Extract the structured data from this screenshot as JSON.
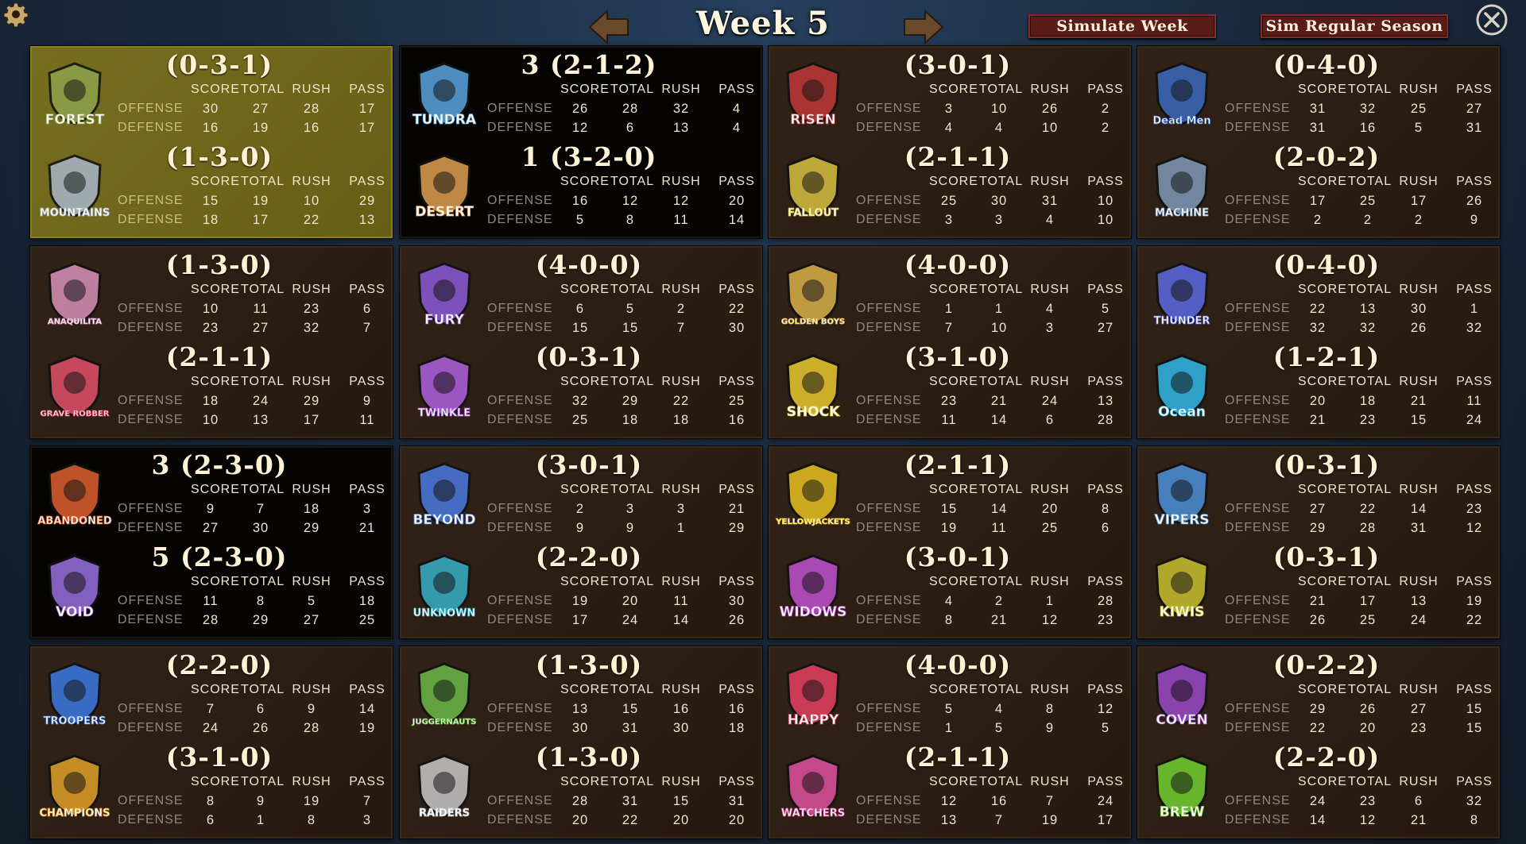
{
  "screen_title": "Week 5",
  "buttons": {
    "simulate_week": "Simulate Week",
    "sim_regular_season": "Sim Regular Season"
  },
  "stat_headers": [
    "SCORE",
    "TOTAL",
    "RUSH",
    "PASS"
  ],
  "row_labels": [
    "OFFENSE",
    "DEFENSE"
  ],
  "matchups": [
    {
      "state": "selected",
      "teams": [
        {
          "name": "FOREST",
          "logo_color": "#8fa24a",
          "record": "(0-3-1)",
          "offense": [
            30,
            27,
            28,
            17
          ],
          "defense": [
            16,
            19,
            16,
            17
          ]
        },
        {
          "name": "MOUNTAINS",
          "logo_color": "#a9b6c8",
          "record": "(1-3-0)",
          "offense": [
            15,
            19,
            10,
            29
          ],
          "defense": [
            18,
            17,
            22,
            13
          ]
        }
      ]
    },
    {
      "state": "live",
      "teams": [
        {
          "name": "TUNDRA",
          "logo_color": "#5aa6e0",
          "record": "3 (2-1-2)",
          "offense": [
            26,
            28,
            32,
            4
          ],
          "defense": [
            12,
            6,
            13,
            4
          ]
        },
        {
          "name": "DESERT",
          "logo_color": "#e0a050",
          "record": "1 (3-2-0)",
          "offense": [
            16,
            12,
            12,
            20
          ],
          "defense": [
            5,
            8,
            11,
            14
          ]
        }
      ]
    },
    {
      "state": "normal",
      "teams": [
        {
          "name": "RISEN",
          "logo_color": "#c03838",
          "record": "(3-0-1)",
          "offense": [
            3,
            10,
            26,
            2
          ],
          "defense": [
            4,
            4,
            10,
            2
          ]
        },
        {
          "name": "FALLOUT",
          "logo_color": "#d8c040",
          "record": "(2-1-1)",
          "offense": [
            25,
            30,
            31,
            10
          ],
          "defense": [
            3,
            3,
            4,
            10
          ]
        }
      ]
    },
    {
      "state": "normal",
      "teams": [
        {
          "name": "Dead Men",
          "logo_color": "#3a6ac0",
          "record": "(0-4-0)",
          "offense": [
            31,
            32,
            25,
            27
          ],
          "defense": [
            31,
            16,
            5,
            31
          ]
        },
        {
          "name": "MACHINE",
          "logo_color": "#7e9ab8",
          "record": "(2-0-2)",
          "offense": [
            17,
            25,
            17,
            26
          ],
          "defense": [
            2,
            2,
            2,
            9
          ]
        }
      ]
    },
    {
      "state": "normal",
      "teams": [
        {
          "name": "ANAQUILITA",
          "logo_color": "#d890b8",
          "record": "(1-3-0)",
          "offense": [
            10,
            11,
            23,
            6
          ],
          "defense": [
            23,
            27,
            32,
            7
          ]
        },
        {
          "name": "GRAVE ROBBER",
          "logo_color": "#e0506a",
          "record": "(2-1-1)",
          "offense": [
            18,
            24,
            29,
            9
          ],
          "defense": [
            10,
            13,
            17,
            11
          ]
        }
      ]
    },
    {
      "state": "normal",
      "teams": [
        {
          "name": "FURY",
          "logo_color": "#8a5ad8",
          "record": "(4-0-0)",
          "offense": [
            6,
            5,
            2,
            22
          ],
          "defense": [
            15,
            15,
            7,
            30
          ]
        },
        {
          "name": "TWINKLE",
          "logo_color": "#b060e0",
          "record": "(0-3-1)",
          "offense": [
            32,
            29,
            22,
            25
          ],
          "defense": [
            25,
            18,
            18,
            16
          ]
        }
      ]
    },
    {
      "state": "normal",
      "teams": [
        {
          "name": "GOLDEN BOYS",
          "logo_color": "#d8b048",
          "record": "(4-0-0)",
          "offense": [
            1,
            1,
            4,
            5
          ],
          "defense": [
            7,
            10,
            3,
            27
          ]
        },
        {
          "name": "SHOCK",
          "logo_color": "#e8c830",
          "record": "(3-1-0)",
          "offense": [
            23,
            21,
            24,
            13
          ],
          "defense": [
            11,
            14,
            6,
            28
          ]
        }
      ]
    },
    {
      "state": "normal",
      "teams": [
        {
          "name": "THUNDER",
          "logo_color": "#5a6ae0",
          "record": "(0-4-0)",
          "offense": [
            22,
            13,
            30,
            1
          ],
          "defense": [
            32,
            32,
            26,
            32
          ]
        },
        {
          "name": "Ocean",
          "logo_color": "#30b8e8",
          "record": "(1-2-1)",
          "offense": [
            20,
            18,
            21,
            11
          ],
          "defense": [
            21,
            23,
            15,
            24
          ]
        }
      ]
    },
    {
      "state": "live",
      "teams": [
        {
          "name": "ABANDONED",
          "logo_color": "#e06030",
          "record": "3 (2-3-0)",
          "offense": [
            9,
            7,
            18,
            3
          ],
          "defense": [
            27,
            30,
            29,
            21
          ]
        },
        {
          "name": "VOID",
          "logo_color": "#9a70e0",
          "record": "5 (2-3-0)",
          "offense": [
            11,
            8,
            5,
            18
          ],
          "defense": [
            28,
            29,
            27,
            25
          ]
        }
      ]
    },
    {
      "state": "normal",
      "teams": [
        {
          "name": "BEYOND",
          "logo_color": "#4a7ae0",
          "record": "(3-0-1)",
          "offense": [
            2,
            3,
            3,
            21
          ],
          "defense": [
            9,
            9,
            1,
            29
          ]
        },
        {
          "name": "UNKNOWN",
          "logo_color": "#38b0c8",
          "record": "(2-2-0)",
          "offense": [
            19,
            20,
            11,
            30
          ],
          "defense": [
            17,
            24,
            14,
            26
          ]
        }
      ]
    },
    {
      "state": "normal",
      "teams": [
        {
          "name": "YELLOWJACKETS",
          "logo_color": "#e8c020",
          "record": "(2-1-1)",
          "offense": [
            15,
            14,
            20,
            8
          ],
          "defense": [
            19,
            11,
            25,
            6
          ]
        },
        {
          "name": "WIDOWS",
          "logo_color": "#c050d0",
          "record": "(3-0-1)",
          "offense": [
            4,
            2,
            1,
            28
          ],
          "defense": [
            8,
            21,
            12,
            23
          ]
        }
      ]
    },
    {
      "state": "normal",
      "teams": [
        {
          "name": "VIPERS",
          "logo_color": "#4a90d8",
          "record": "(0-3-1)",
          "offense": [
            27,
            22,
            14,
            23
          ],
          "defense": [
            29,
            28,
            31,
            12
          ]
        },
        {
          "name": "KIWIS",
          "logo_color": "#c8c030",
          "record": "(0-3-1)",
          "offense": [
            21,
            17,
            13,
            19
          ],
          "defense": [
            26,
            25,
            24,
            22
          ]
        }
      ]
    },
    {
      "state": "normal",
      "teams": [
        {
          "name": "TROOPERS",
          "logo_color": "#3a78e0",
          "record": "(2-2-0)",
          "offense": [
            7,
            6,
            9,
            14
          ],
          "defense": [
            24,
            26,
            28,
            19
          ]
        },
        {
          "name": "CHAMPIONS",
          "logo_color": "#e0a028",
          "record": "(3-1-0)",
          "offense": [
            8,
            9,
            19,
            7
          ],
          "defense": [
            6,
            1,
            8,
            3
          ]
        }
      ]
    },
    {
      "state": "normal",
      "teams": [
        {
          "name": "JUGGERNAUTS",
          "logo_color": "#6ab848",
          "record": "(1-3-0)",
          "offense": [
            13,
            15,
            16,
            16
          ],
          "defense": [
            30,
            31,
            30,
            18
          ]
        },
        {
          "name": "RAIDERS",
          "logo_color": "#c8c8c8",
          "record": "(1-3-0)",
          "offense": [
            28,
            31,
            15,
            31
          ],
          "defense": [
            20,
            22,
            20,
            20
          ]
        }
      ]
    },
    {
      "state": "normal",
      "teams": [
        {
          "name": "HAPPY",
          "logo_color": "#e84060",
          "record": "(4-0-0)",
          "offense": [
            5,
            4,
            8,
            12
          ],
          "defense": [
            1,
            5,
            9,
            5
          ]
        },
        {
          "name": "WATCHERS",
          "logo_color": "#e050a0",
          "record": "(2-1-1)",
          "offense": [
            12,
            16,
            7,
            24
          ],
          "defense": [
            13,
            7,
            19,
            17
          ]
        }
      ]
    },
    {
      "state": "normal",
      "teams": [
        {
          "name": "COVEN",
          "logo_color": "#9a48c8",
          "record": "(0-2-2)",
          "offense": [
            29,
            26,
            27,
            15
          ],
          "defense": [
            22,
            20,
            23,
            15
          ]
        },
        {
          "name": "BREW",
          "logo_color": "#70d030",
          "record": "(2-2-0)",
          "offense": [
            24,
            23,
            6,
            32
          ],
          "defense": [
            14,
            12,
            21,
            8
          ]
        }
      ]
    }
  ]
}
